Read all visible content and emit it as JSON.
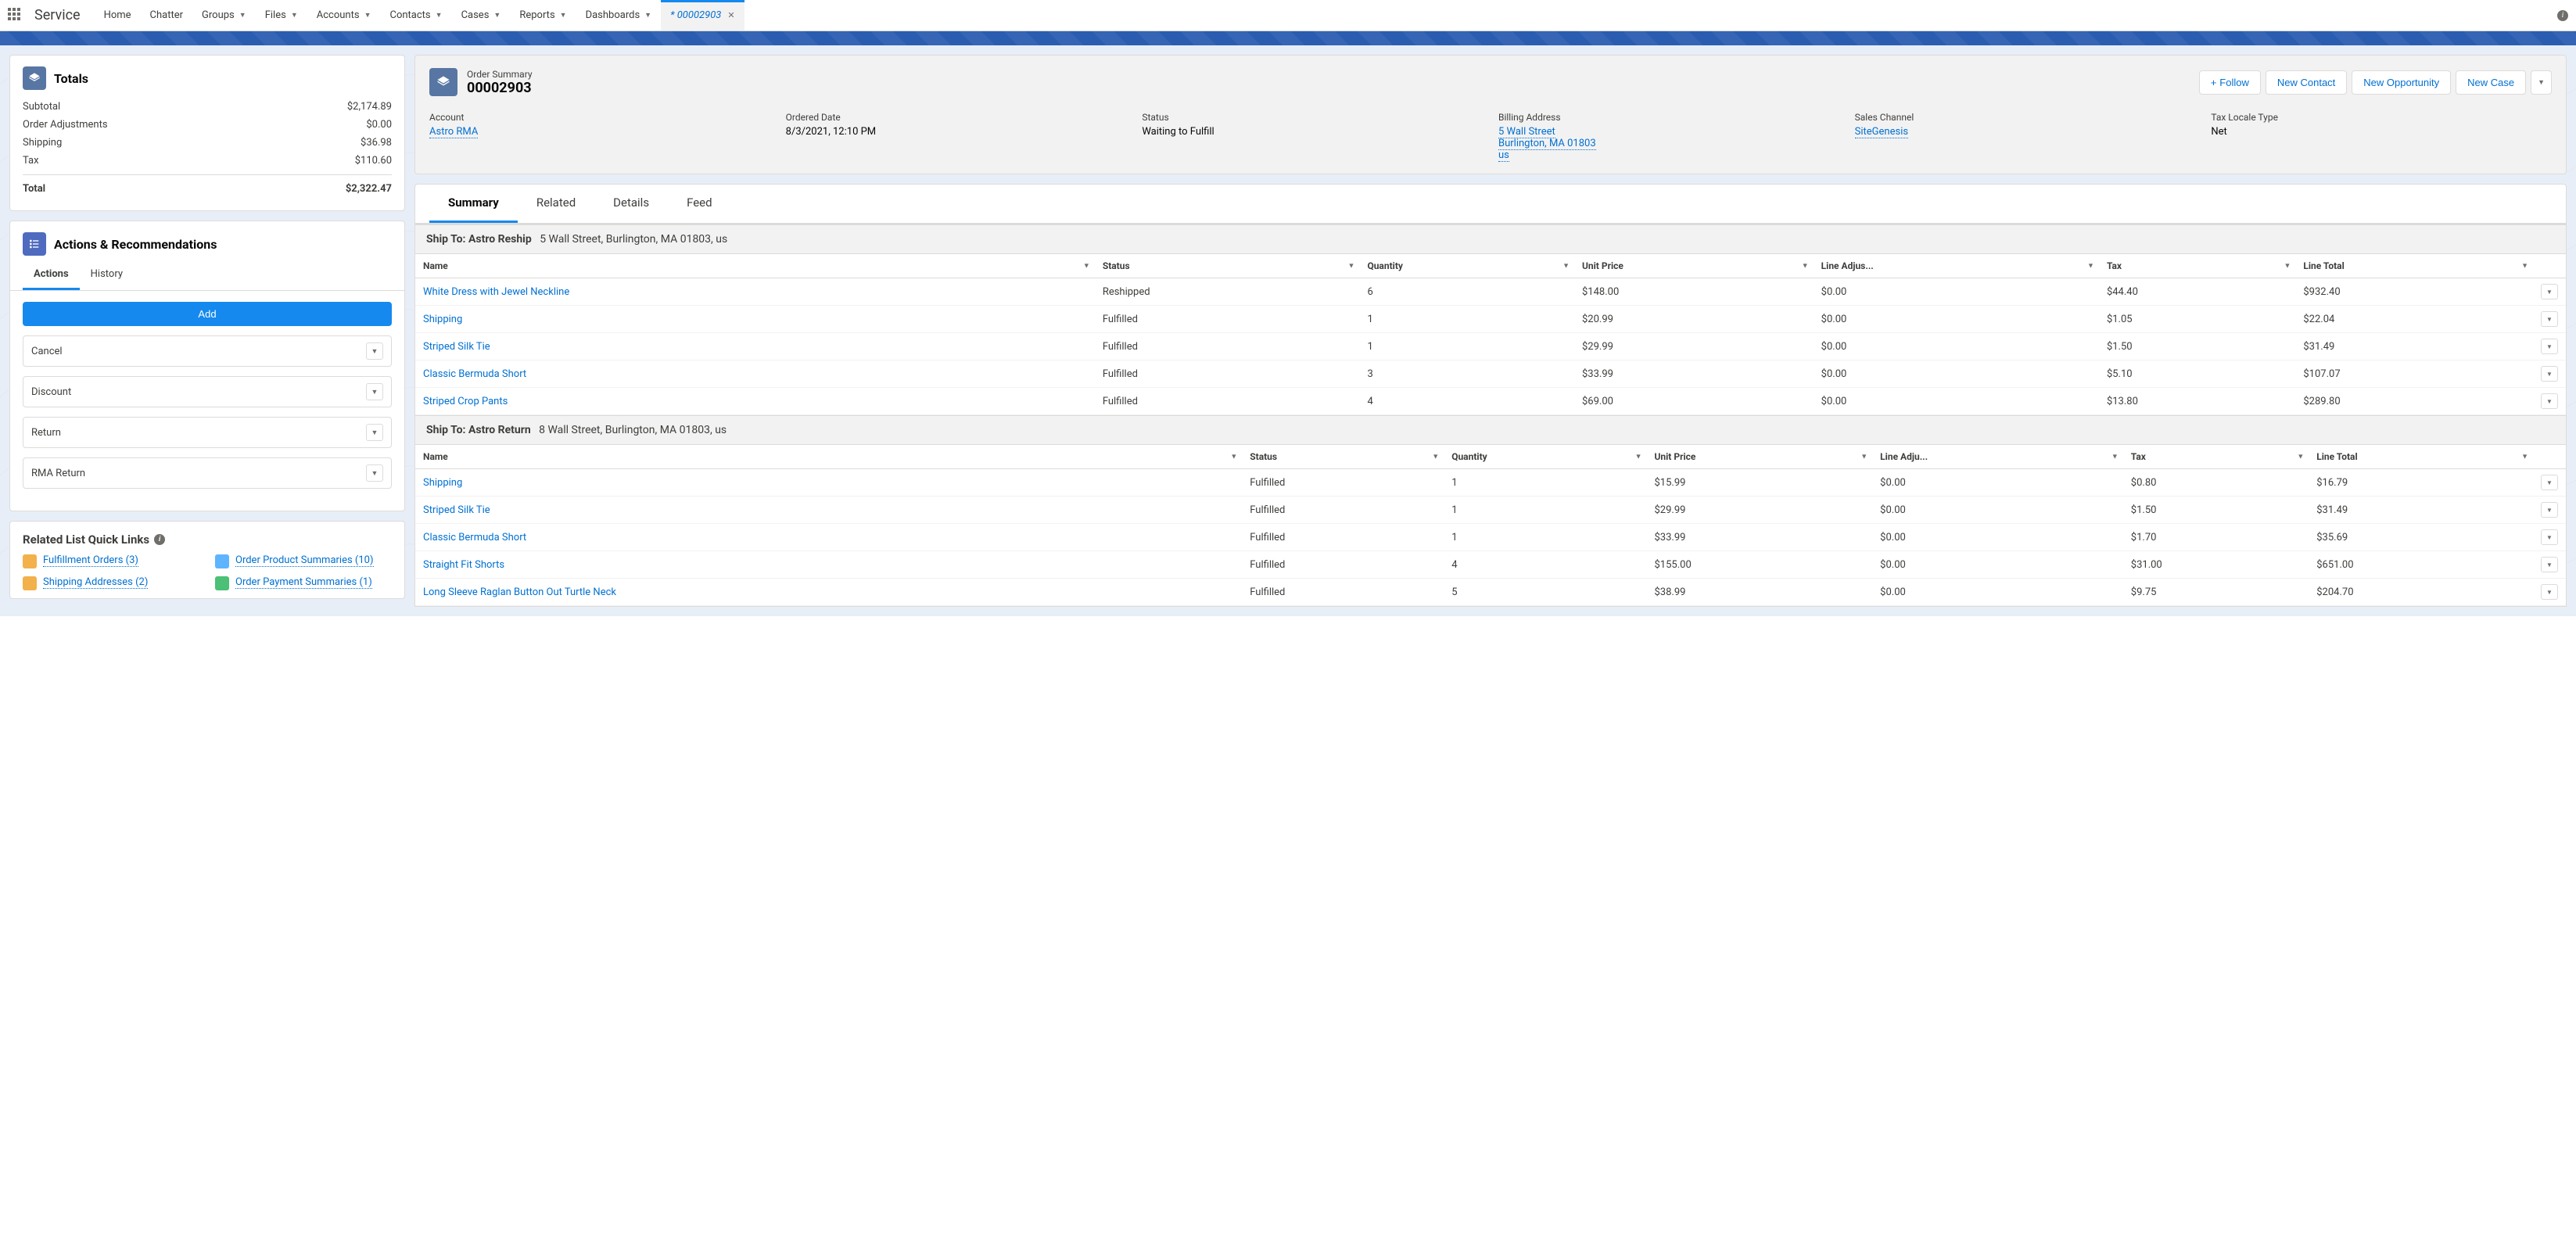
{
  "topbar": {
    "app_name": "Service",
    "nav": [
      "Home",
      "Chatter",
      "Groups",
      "Files",
      "Accounts",
      "Contacts",
      "Cases",
      "Reports",
      "Dashboards"
    ],
    "nav_has_chev": [
      false,
      false,
      true,
      true,
      true,
      true,
      true,
      true,
      true
    ],
    "active_tab": "* 00002903"
  },
  "totals": {
    "title": "Totals",
    "rows": [
      {
        "label": "Subtotal",
        "value": "$2,174.89"
      },
      {
        "label": "Order Adjustments",
        "value": "$0.00"
      },
      {
        "label": "Shipping",
        "value": "$36.98"
      },
      {
        "label": "Tax",
        "value": "$110.60"
      }
    ],
    "total_label": "Total",
    "total_value": "$2,322.47"
  },
  "actions_rec": {
    "title": "Actions & Recommendations",
    "tabs": [
      "Actions",
      "History"
    ],
    "add_label": "Add",
    "items": [
      "Cancel",
      "Discount",
      "Return",
      "RMA Return"
    ]
  },
  "quick_links": {
    "title": "Related List Quick Links",
    "items": [
      {
        "label": "Fulfillment Orders (3)",
        "color": "#f2b14b"
      },
      {
        "label": "Order Product Summaries (10)",
        "color": "#5eb4ff"
      },
      {
        "label": "Shipping Addresses (2)",
        "color": "#f2b14b"
      },
      {
        "label": "Order Payment Summaries (1)",
        "color": "#4bc076"
      }
    ]
  },
  "order": {
    "label": "Order Summary",
    "number": "00002903",
    "actions": {
      "follow": "Follow",
      "new_contact": "New Contact",
      "new_opportunity": "New Opportunity",
      "new_case": "New Case"
    },
    "details": {
      "account_label": "Account",
      "account_value": "Astro RMA",
      "ordered_date_label": "Ordered Date",
      "ordered_date_value": "8/3/2021, 12:10 PM",
      "status_label": "Status",
      "status_value": "Waiting to Fulfill",
      "billing_label": "Billing Address",
      "billing_line1": "5 Wall Street",
      "billing_line2": "Burlington, MA 01803",
      "billing_line3": "us",
      "sales_channel_label": "Sales Channel",
      "sales_channel_value": "SiteGenesis",
      "tax_locale_label": "Tax Locale Type",
      "tax_locale_value": "Net"
    }
  },
  "record_tabs": [
    "Summary",
    "Related",
    "Details",
    "Feed"
  ],
  "table_headers": [
    "Name",
    "Status",
    "Quantity",
    "Unit Price",
    "Line Adjus...",
    "Tax",
    "Line Total"
  ],
  "table_headers_b": [
    "Name",
    "Status",
    "Quantity",
    "Unit Price",
    "Line Adju...",
    "Tax",
    "Line Total"
  ],
  "ship_to_a": {
    "label_prefix": "Ship To: ",
    "name": "Astro Reship",
    "address": "5 Wall Street, Burlington, MA  01803, us",
    "rows": [
      {
        "name": "White Dress with Jewel Neckline",
        "status": "Reshipped",
        "qty": "6",
        "unit": "$148.00",
        "adj": "$0.00",
        "tax": "$44.40",
        "total": "$932.40"
      },
      {
        "name": "Shipping",
        "status": "Fulfilled",
        "qty": "1",
        "unit": "$20.99",
        "adj": "$0.00",
        "tax": "$1.05",
        "total": "$22.04"
      },
      {
        "name": "Striped Silk Tie",
        "status": "Fulfilled",
        "qty": "1",
        "unit": "$29.99",
        "adj": "$0.00",
        "tax": "$1.50",
        "total": "$31.49"
      },
      {
        "name": "Classic Bermuda Short",
        "status": "Fulfilled",
        "qty": "3",
        "unit": "$33.99",
        "adj": "$0.00",
        "tax": "$5.10",
        "total": "$107.07"
      },
      {
        "name": "Striped Crop Pants",
        "status": "Fulfilled",
        "qty": "4",
        "unit": "$69.00",
        "adj": "$0.00",
        "tax": "$13.80",
        "total": "$289.80"
      }
    ]
  },
  "ship_to_b": {
    "label_prefix": "Ship To: ",
    "name": "Astro Return",
    "address": "8 Wall Street, Burlington, MA  01803, us",
    "rows": [
      {
        "name": "Shipping",
        "status": "Fulfilled",
        "qty": "1",
        "unit": "$15.99",
        "adj": "$0.00",
        "tax": "$0.80",
        "total": "$16.79"
      },
      {
        "name": "Striped Silk Tie",
        "status": "Fulfilled",
        "qty": "1",
        "unit": "$29.99",
        "adj": "$0.00",
        "tax": "$1.50",
        "total": "$31.49"
      },
      {
        "name": "Classic Bermuda Short",
        "status": "Fulfilled",
        "qty": "1",
        "unit": "$33.99",
        "adj": "$0.00",
        "tax": "$1.70",
        "total": "$35.69"
      },
      {
        "name": "Straight Fit Shorts",
        "status": "Fulfilled",
        "qty": "4",
        "unit": "$155.00",
        "adj": "$0.00",
        "tax": "$31.00",
        "total": "$651.00"
      },
      {
        "name": "Long Sleeve Raglan Button Out Turtle Neck",
        "status": "Fulfilled",
        "qty": "5",
        "unit": "$38.99",
        "adj": "$0.00",
        "tax": "$9.75",
        "total": "$204.70"
      }
    ]
  }
}
